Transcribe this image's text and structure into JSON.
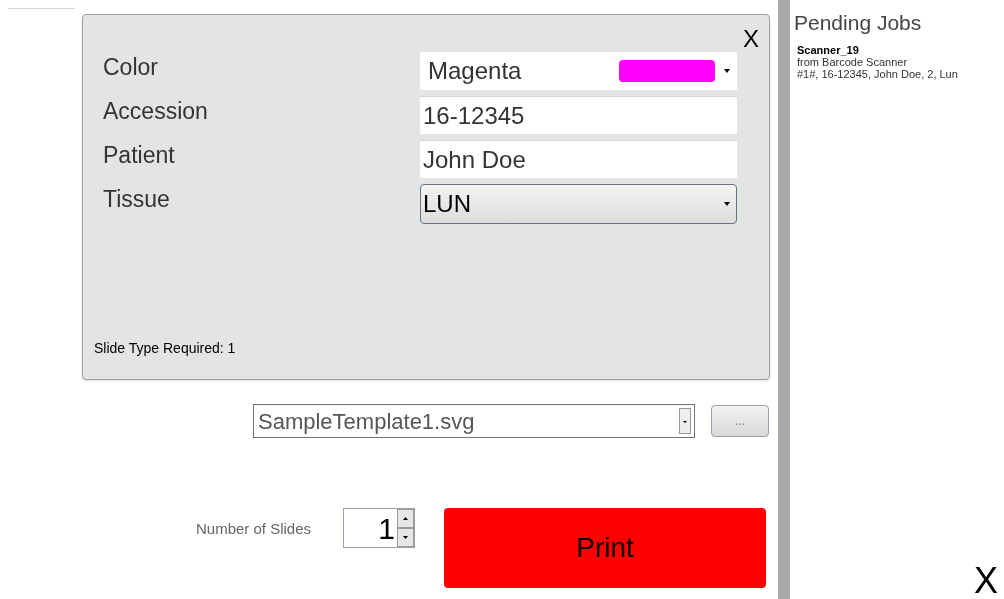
{
  "form": {
    "close": "X",
    "fields": [
      {
        "label": "Color",
        "kind": "color-select",
        "value": "Magenta",
        "color": "#ff00ff"
      },
      {
        "label": "Accession",
        "kind": "text",
        "value": "16-12345"
      },
      {
        "label": "Patient",
        "kind": "text",
        "value": "John Doe"
      },
      {
        "label": "Tissue",
        "kind": "select",
        "value": "LUN"
      }
    ],
    "footnote": "Slide Type Required: 1"
  },
  "template": {
    "value": "SampleTemplate1.svg",
    "browse": "..."
  },
  "slides": {
    "label": "Number of Slides",
    "value": "1"
  },
  "print": "Print",
  "pending": {
    "title": "Pending Jobs",
    "jobs": [
      {
        "name": "Scanner_19",
        "source": "from Barcode Scanner",
        "details": "#1#, 16-12345, John Doe, 2, Lun"
      }
    ]
  },
  "close": "X"
}
